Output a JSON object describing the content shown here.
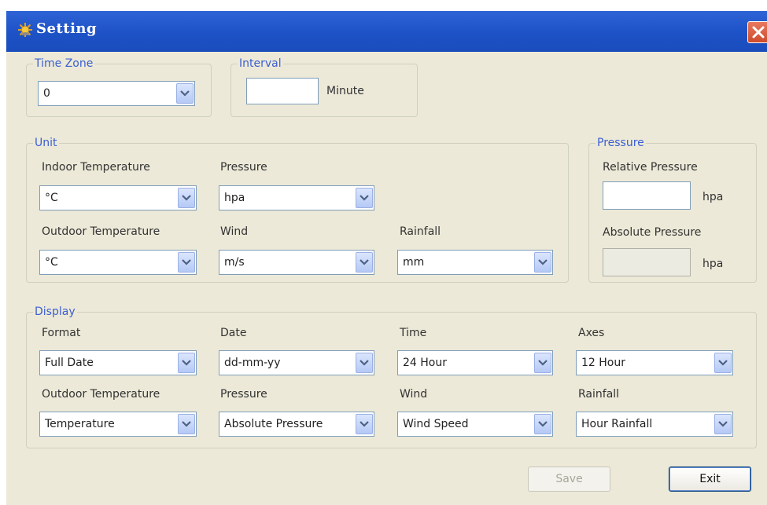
{
  "window": {
    "title": "Setting"
  },
  "time_zone": {
    "legend": "Time Zone",
    "value": "0"
  },
  "interval": {
    "legend": "Interval",
    "value": "",
    "unit": "Minute"
  },
  "unit": {
    "legend": "Unit",
    "indoor_temperature": {
      "label": "Indoor Temperature",
      "value": "°C"
    },
    "pressure": {
      "label": "Pressure",
      "value": "hpa"
    },
    "outdoor_temperature": {
      "label": "Outdoor Temperature",
      "value": "°C"
    },
    "wind": {
      "label": "Wind",
      "value": "m/s"
    },
    "rainfall": {
      "label": "Rainfall",
      "value": "mm"
    }
  },
  "pressure": {
    "legend": "Pressure",
    "relative": {
      "label": "Relative Pressure",
      "value": "",
      "unit": "hpa"
    },
    "absolute": {
      "label": "Absolute Pressure",
      "value": "",
      "unit": "hpa"
    }
  },
  "display": {
    "legend": "Display",
    "format": {
      "label": "Format",
      "value": "Full Date"
    },
    "date": {
      "label": "Date",
      "value": "dd-mm-yy"
    },
    "time": {
      "label": "Time",
      "value": "24 Hour"
    },
    "axes": {
      "label": "Axes",
      "value": "12 Hour"
    },
    "outdoor_temperature": {
      "label": "Outdoor Temperature",
      "value": "Temperature"
    },
    "pressure": {
      "label": "Pressure",
      "value": "Absolute Pressure"
    },
    "wind": {
      "label": "Wind",
      "value": "Wind Speed"
    },
    "rainfall": {
      "label": "Rainfall",
      "value": "Hour Rainfall"
    }
  },
  "buttons": {
    "save": "Save",
    "exit": "Exit"
  },
  "colors": {
    "titlebar": "#1d52c6",
    "legend_text": "#3c5fd1",
    "client_bg": "#ece9d8",
    "close_button": "#d9583a"
  },
  "icons": {
    "app": "sun-icon",
    "close": "close-icon",
    "dropdown": "chevron-down-icon"
  }
}
